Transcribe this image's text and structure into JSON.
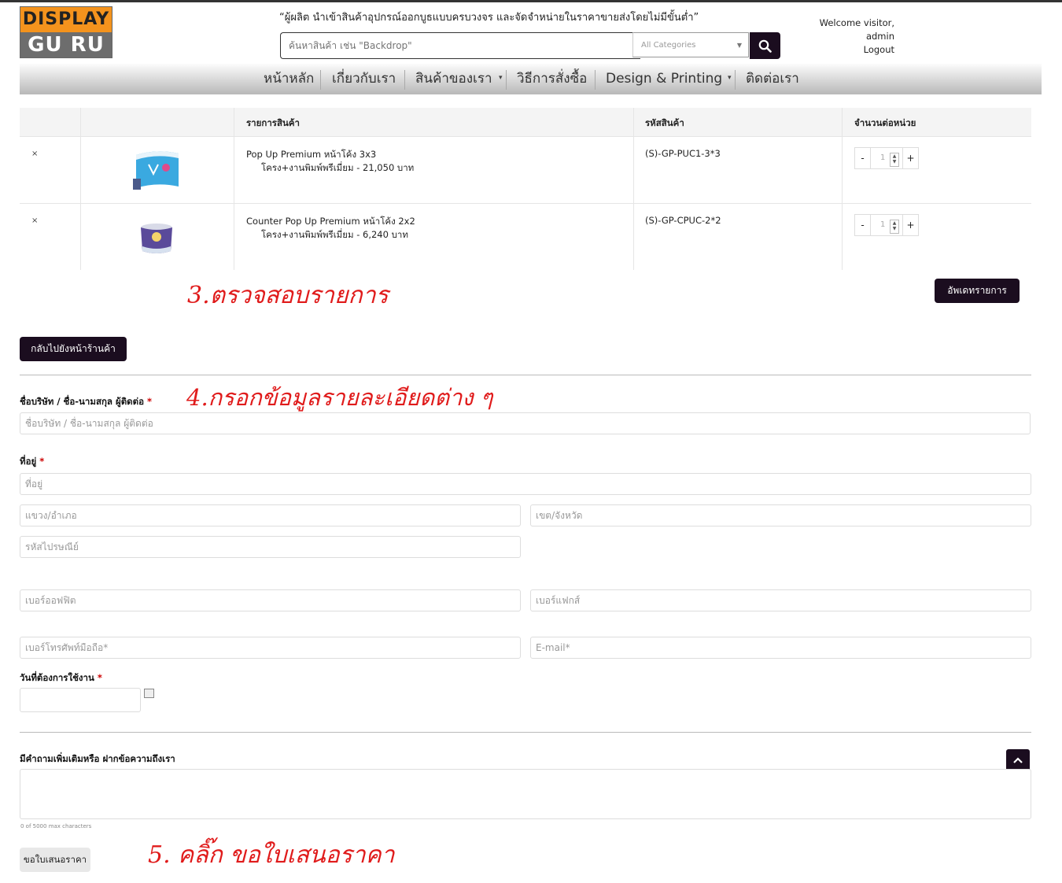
{
  "logo": {
    "line1": "DISPLAY",
    "line2": "GU RU"
  },
  "header": {
    "tagline": "“ผู้ผลิต นำเข้าสินค้าอุปกรณ์ออกบูธแบบครบวงจร และจัดจำหน่ายในราคาขายส่งโดยไม่มีขั้นต่ำ”",
    "search_placeholder": "ค้นหาสินค้า เช่น \"Backdrop\"",
    "category": "All Categories",
    "welcome": "Welcome visitor, admin",
    "logout": "Logout"
  },
  "nav": {
    "home": "หน้าหลัก",
    "about": "เกี่ยวกับเรา",
    "products": "สินค้าของเรา",
    "howto": "วิธีการสั่งซื้อ",
    "design": "Design & Printing",
    "contact": "ติดต่อเรา"
  },
  "cart": {
    "headers": {
      "item": "รายการสินค้า",
      "sku": "รหัสสินค้า",
      "qty": "จำนวนต่อหน่วย"
    },
    "rows": [
      {
        "remove": "×",
        "name": "Pop Up Premium หน้าโค้ง 3x3",
        "option": "โครง+งานพิมพ์พรีเมี่ยม - 21,050 บาท",
        "sku": "(S)-GP-PUC1-3*3",
        "qty": "1"
      },
      {
        "remove": "×",
        "name": "Counter Pop Up Premium หน้าโค้ง 2x2",
        "option": "โครง+งานพิมพ์พรีเมี่ยม - 6,240 บาท",
        "sku": "(S)-GP-CPUC-2*2",
        "qty": "1"
      }
    ],
    "minus": "-",
    "plus": "+",
    "update_button": "อัพเดทรายการ",
    "back_button": "กลับไปยังหน้าร้านค้า"
  },
  "annotations": {
    "step3": "3.ตรวจสอบรายการ",
    "step4": "4.กรอกข้อมูลรายละเอียดต่าง ๆ",
    "step5": "5. คลิ๊ก ขอใบเสนอราคา"
  },
  "form": {
    "company_label": "ชื่อบริษัท / ชื่อ-นามสกุล ผู้ติดต่อ",
    "company_placeholder": "ชื่อบริษัท / ชื่อ-นามสกุล ผู้ติดต่อ",
    "address_label": "ที่อยู่",
    "address_placeholder": "ที่อยู่",
    "district_placeholder": "แขวง/อำเภอ",
    "province_placeholder": "เขต/จังหวัด",
    "zip_placeholder": "รหัสไปรษณีย์",
    "office_placeholder": "เบอร์ออฟฟิต",
    "fax_placeholder": "เบอร์แฟกส์",
    "mobile_placeholder": "เบอร์โทรศัพท์มือถือ*",
    "email_placeholder": "E-mail*",
    "date_label": "วันที่ต้องการใช้งาน",
    "message_label": "มีคำถามเพิ่มเติมหรือ ฝากข้อความถึงเรา",
    "char_count": "0 of 5000 max characters",
    "submit": "ขอใบเสนอราคา",
    "required_mark": "*"
  },
  "colors": {
    "accent_dark": "#1b0d1f",
    "logo_orange": "#f4931d",
    "annotation_red": "#e01b1b"
  }
}
